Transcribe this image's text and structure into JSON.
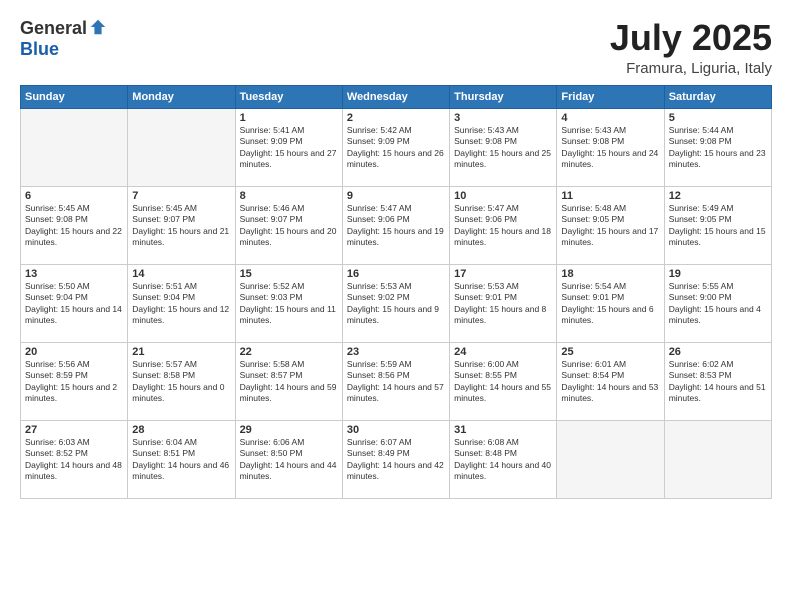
{
  "logo": {
    "general": "General",
    "blue": "Blue"
  },
  "title": "July 2025",
  "location": "Framura, Liguria, Italy",
  "days_of_week": [
    "Sunday",
    "Monday",
    "Tuesday",
    "Wednesday",
    "Thursday",
    "Friday",
    "Saturday"
  ],
  "weeks": [
    [
      {
        "day": "",
        "sunrise": "",
        "sunset": "",
        "daylight": ""
      },
      {
        "day": "",
        "sunrise": "",
        "sunset": "",
        "daylight": ""
      },
      {
        "day": "1",
        "sunrise": "Sunrise: 5:41 AM",
        "sunset": "Sunset: 9:09 PM",
        "daylight": "Daylight: 15 hours and 27 minutes."
      },
      {
        "day": "2",
        "sunrise": "Sunrise: 5:42 AM",
        "sunset": "Sunset: 9:09 PM",
        "daylight": "Daylight: 15 hours and 26 minutes."
      },
      {
        "day": "3",
        "sunrise": "Sunrise: 5:43 AM",
        "sunset": "Sunset: 9:08 PM",
        "daylight": "Daylight: 15 hours and 25 minutes."
      },
      {
        "day": "4",
        "sunrise": "Sunrise: 5:43 AM",
        "sunset": "Sunset: 9:08 PM",
        "daylight": "Daylight: 15 hours and 24 minutes."
      },
      {
        "day": "5",
        "sunrise": "Sunrise: 5:44 AM",
        "sunset": "Sunset: 9:08 PM",
        "daylight": "Daylight: 15 hours and 23 minutes."
      }
    ],
    [
      {
        "day": "6",
        "sunrise": "Sunrise: 5:45 AM",
        "sunset": "Sunset: 9:08 PM",
        "daylight": "Daylight: 15 hours and 22 minutes."
      },
      {
        "day": "7",
        "sunrise": "Sunrise: 5:45 AM",
        "sunset": "Sunset: 9:07 PM",
        "daylight": "Daylight: 15 hours and 21 minutes."
      },
      {
        "day": "8",
        "sunrise": "Sunrise: 5:46 AM",
        "sunset": "Sunset: 9:07 PM",
        "daylight": "Daylight: 15 hours and 20 minutes."
      },
      {
        "day": "9",
        "sunrise": "Sunrise: 5:47 AM",
        "sunset": "Sunset: 9:06 PM",
        "daylight": "Daylight: 15 hours and 19 minutes."
      },
      {
        "day": "10",
        "sunrise": "Sunrise: 5:47 AM",
        "sunset": "Sunset: 9:06 PM",
        "daylight": "Daylight: 15 hours and 18 minutes."
      },
      {
        "day": "11",
        "sunrise": "Sunrise: 5:48 AM",
        "sunset": "Sunset: 9:05 PM",
        "daylight": "Daylight: 15 hours and 17 minutes."
      },
      {
        "day": "12",
        "sunrise": "Sunrise: 5:49 AM",
        "sunset": "Sunset: 9:05 PM",
        "daylight": "Daylight: 15 hours and 15 minutes."
      }
    ],
    [
      {
        "day": "13",
        "sunrise": "Sunrise: 5:50 AM",
        "sunset": "Sunset: 9:04 PM",
        "daylight": "Daylight: 15 hours and 14 minutes."
      },
      {
        "day": "14",
        "sunrise": "Sunrise: 5:51 AM",
        "sunset": "Sunset: 9:04 PM",
        "daylight": "Daylight: 15 hours and 12 minutes."
      },
      {
        "day": "15",
        "sunrise": "Sunrise: 5:52 AM",
        "sunset": "Sunset: 9:03 PM",
        "daylight": "Daylight: 15 hours and 11 minutes."
      },
      {
        "day": "16",
        "sunrise": "Sunrise: 5:53 AM",
        "sunset": "Sunset: 9:02 PM",
        "daylight": "Daylight: 15 hours and 9 minutes."
      },
      {
        "day": "17",
        "sunrise": "Sunrise: 5:53 AM",
        "sunset": "Sunset: 9:01 PM",
        "daylight": "Daylight: 15 hours and 8 minutes."
      },
      {
        "day": "18",
        "sunrise": "Sunrise: 5:54 AM",
        "sunset": "Sunset: 9:01 PM",
        "daylight": "Daylight: 15 hours and 6 minutes."
      },
      {
        "day": "19",
        "sunrise": "Sunrise: 5:55 AM",
        "sunset": "Sunset: 9:00 PM",
        "daylight": "Daylight: 15 hours and 4 minutes."
      }
    ],
    [
      {
        "day": "20",
        "sunrise": "Sunrise: 5:56 AM",
        "sunset": "Sunset: 8:59 PM",
        "daylight": "Daylight: 15 hours and 2 minutes."
      },
      {
        "day": "21",
        "sunrise": "Sunrise: 5:57 AM",
        "sunset": "Sunset: 8:58 PM",
        "daylight": "Daylight: 15 hours and 0 minutes."
      },
      {
        "day": "22",
        "sunrise": "Sunrise: 5:58 AM",
        "sunset": "Sunset: 8:57 PM",
        "daylight": "Daylight: 14 hours and 59 minutes."
      },
      {
        "day": "23",
        "sunrise": "Sunrise: 5:59 AM",
        "sunset": "Sunset: 8:56 PM",
        "daylight": "Daylight: 14 hours and 57 minutes."
      },
      {
        "day": "24",
        "sunrise": "Sunrise: 6:00 AM",
        "sunset": "Sunset: 8:55 PM",
        "daylight": "Daylight: 14 hours and 55 minutes."
      },
      {
        "day": "25",
        "sunrise": "Sunrise: 6:01 AM",
        "sunset": "Sunset: 8:54 PM",
        "daylight": "Daylight: 14 hours and 53 minutes."
      },
      {
        "day": "26",
        "sunrise": "Sunrise: 6:02 AM",
        "sunset": "Sunset: 8:53 PM",
        "daylight": "Daylight: 14 hours and 51 minutes."
      }
    ],
    [
      {
        "day": "27",
        "sunrise": "Sunrise: 6:03 AM",
        "sunset": "Sunset: 8:52 PM",
        "daylight": "Daylight: 14 hours and 48 minutes."
      },
      {
        "day": "28",
        "sunrise": "Sunrise: 6:04 AM",
        "sunset": "Sunset: 8:51 PM",
        "daylight": "Daylight: 14 hours and 46 minutes."
      },
      {
        "day": "29",
        "sunrise": "Sunrise: 6:06 AM",
        "sunset": "Sunset: 8:50 PM",
        "daylight": "Daylight: 14 hours and 44 minutes."
      },
      {
        "day": "30",
        "sunrise": "Sunrise: 6:07 AM",
        "sunset": "Sunset: 8:49 PM",
        "daylight": "Daylight: 14 hours and 42 minutes."
      },
      {
        "day": "31",
        "sunrise": "Sunrise: 6:08 AM",
        "sunset": "Sunset: 8:48 PM",
        "daylight": "Daylight: 14 hours and 40 minutes."
      },
      {
        "day": "",
        "sunrise": "",
        "sunset": "",
        "daylight": ""
      },
      {
        "day": "",
        "sunrise": "",
        "sunset": "",
        "daylight": ""
      }
    ]
  ]
}
